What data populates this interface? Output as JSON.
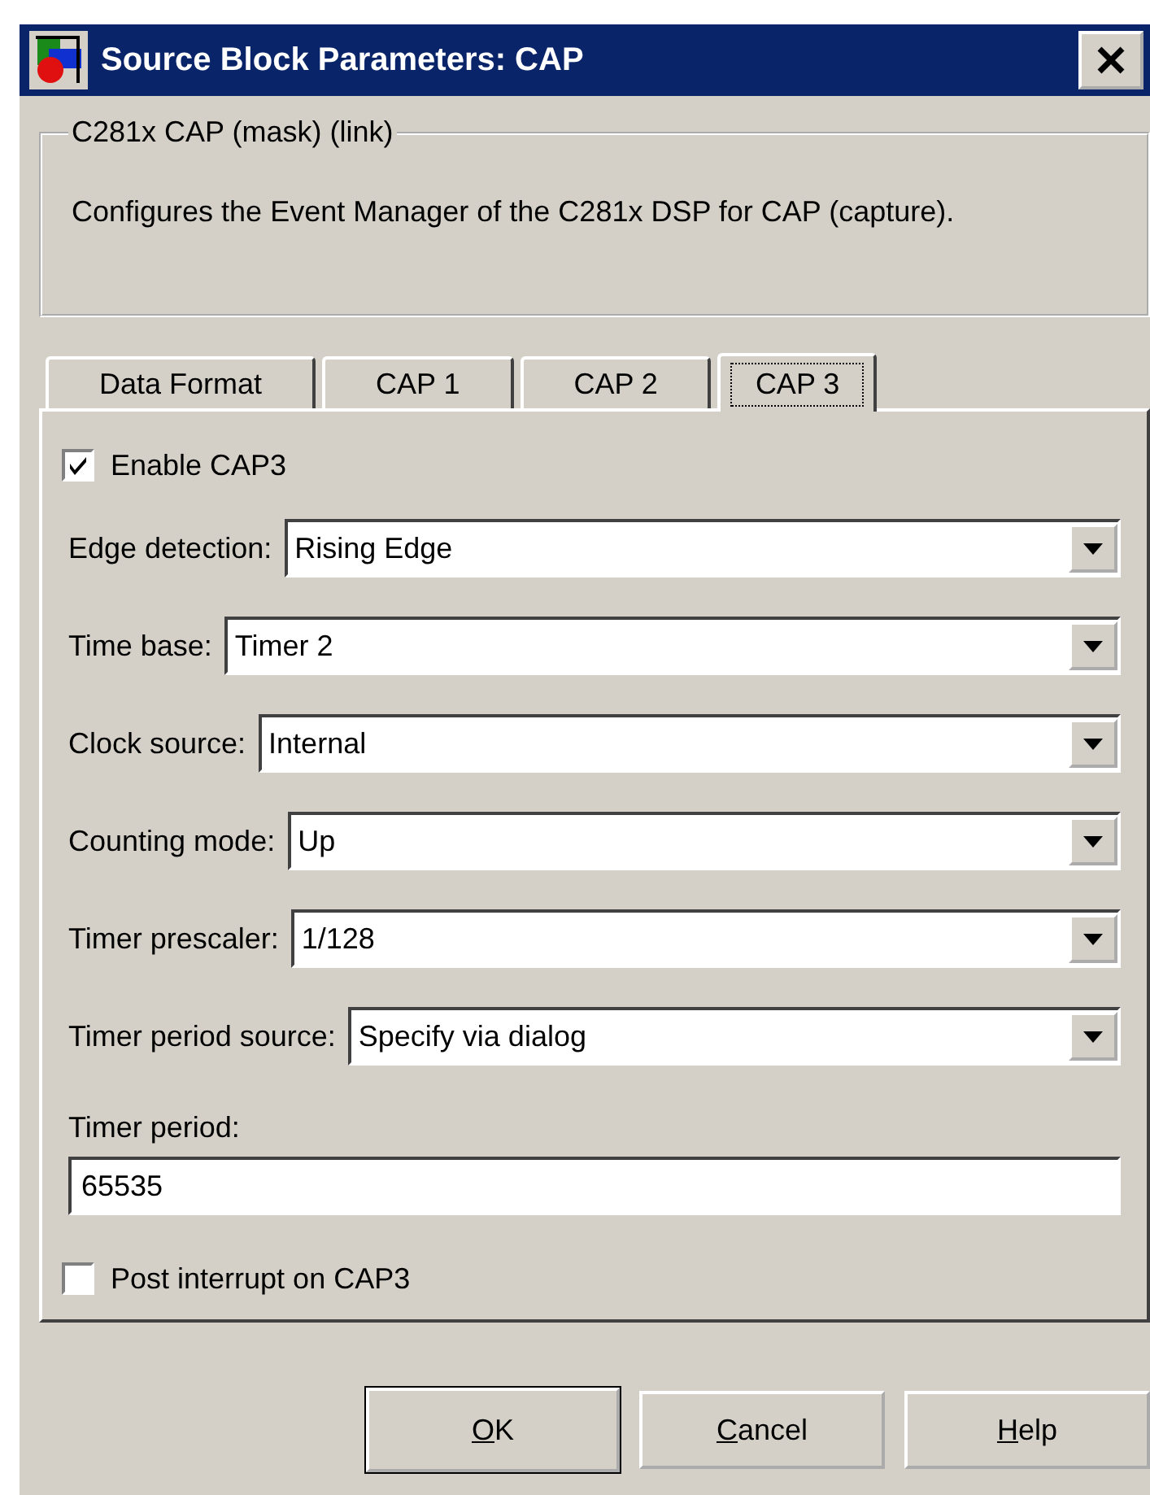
{
  "window": {
    "title": "Source Block Parameters: CAP"
  },
  "group": {
    "title": "C281x CAP (mask) (link)",
    "description": "Configures the Event Manager of the C281x DSP for CAP (capture)."
  },
  "tabs": [
    {
      "label": "Data Format",
      "selected": false
    },
    {
      "label": "CAP 1",
      "selected": false
    },
    {
      "label": "CAP 2",
      "selected": false
    },
    {
      "label": "CAP 3",
      "selected": true
    }
  ],
  "fields": [
    {
      "kind": "checkbox",
      "label": "Enable CAP3",
      "checked": true
    },
    {
      "kind": "dropdown",
      "label": "Edge detection:",
      "value": "Rising Edge"
    },
    {
      "kind": "dropdown",
      "label": "Time base:",
      "value": "Timer 2"
    },
    {
      "kind": "dropdown",
      "label": "Clock source:",
      "value": "Internal"
    },
    {
      "kind": "dropdown",
      "label": "Counting mode:",
      "value": "Up"
    },
    {
      "kind": "dropdown",
      "label": "Timer prescaler:",
      "value": "1/128"
    },
    {
      "kind": "dropdown",
      "label": "Timer period source:",
      "value": "Specify via dialog"
    },
    {
      "kind": "text",
      "label": "Timer period:",
      "value": "65535"
    },
    {
      "kind": "checkbox",
      "label": "Post interrupt on CAP3",
      "checked": false
    }
  ],
  "buttons": [
    {
      "access_key": "O",
      "rest": "K",
      "default": true
    },
    {
      "access_key": "C",
      "rest": "ancel",
      "default": false
    },
    {
      "access_key": "H",
      "rest": "elp",
      "default": false
    }
  ]
}
